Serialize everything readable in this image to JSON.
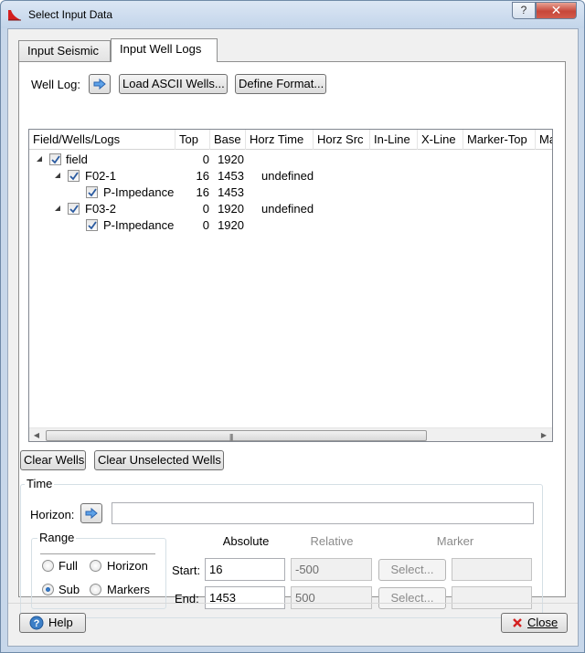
{
  "window": {
    "title": "Select Input Data",
    "help_glyph": "?",
    "close_glyph": "✕"
  },
  "tabs": [
    {
      "label": "Input Seismic",
      "active": false
    },
    {
      "label": "Input Well Logs",
      "active": true
    }
  ],
  "well_log": {
    "label": "Well Log:",
    "load_button": "Load ASCII Wells...",
    "define_button": "Define Format..."
  },
  "tree": {
    "columns": [
      "Field/Wells/Logs",
      "Top",
      "Base",
      "Horz Time",
      "Horz Src",
      "In-Line",
      "X-Line",
      "Marker-Top",
      "Ma"
    ],
    "rows": [
      {
        "name": "field",
        "top": "0",
        "base": "1920",
        "horz_time": "",
        "checked": true,
        "expanded": true
      },
      {
        "name": "F02-1",
        "top": "16",
        "base": "1453",
        "horz_time": "undefined",
        "checked": true,
        "expanded": true
      },
      {
        "name": "P-Impedance",
        "top": "16",
        "base": "1453",
        "horz_time": "",
        "checked": true
      },
      {
        "name": "F03-2",
        "top": "0",
        "base": "1920",
        "horz_time": "undefined",
        "checked": true,
        "expanded": true
      },
      {
        "name": "P-Impedance",
        "top": "0",
        "base": "1920",
        "horz_time": "",
        "checked": true
      }
    ],
    "scroll_grip": "|||"
  },
  "well_buttons": {
    "clear": "Clear Wells",
    "clear_unselected": "Clear Unselected Wells"
  },
  "time": {
    "title": "Time",
    "horizon_label": "Horizon:",
    "horizon_value": "",
    "range": {
      "title": "Range",
      "options": [
        {
          "label": "Full",
          "checked": false
        },
        {
          "label": "Horizon",
          "checked": false
        },
        {
          "label": "Sub",
          "checked": true
        },
        {
          "label": "Markers",
          "checked": false
        }
      ]
    },
    "columns": {
      "absolute": "Absolute",
      "relative": "Relative",
      "marker": "Marker"
    },
    "start": {
      "label": "Start:",
      "absolute": "16",
      "relative": "-500",
      "select": "Select...",
      "marker": ""
    },
    "end": {
      "label": "End:",
      "absolute": "1453",
      "relative": "500",
      "select": "Select...",
      "marker": ""
    }
  },
  "footer": {
    "help": "Help",
    "close": "Close"
  },
  "colors": {
    "accent": "#3c7fc7",
    "close_icon": "#d42020"
  }
}
